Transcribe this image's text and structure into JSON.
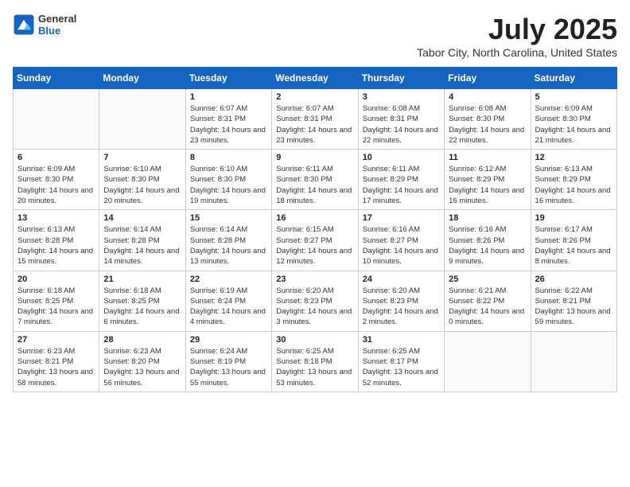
{
  "header": {
    "logo_general": "General",
    "logo_blue": "Blue",
    "main_title": "July 2025",
    "subtitle": "Tabor City, North Carolina, United States"
  },
  "calendar": {
    "days_of_week": [
      "Sunday",
      "Monday",
      "Tuesday",
      "Wednesday",
      "Thursday",
      "Friday",
      "Saturday"
    ],
    "weeks": [
      [
        {
          "day": "",
          "info": ""
        },
        {
          "day": "",
          "info": ""
        },
        {
          "day": "1",
          "info": "Sunrise: 6:07 AM\nSunset: 8:31 PM\nDaylight: 14 hours\nand 23 minutes."
        },
        {
          "day": "2",
          "info": "Sunrise: 6:07 AM\nSunset: 8:31 PM\nDaylight: 14 hours\nand 23 minutes."
        },
        {
          "day": "3",
          "info": "Sunrise: 6:08 AM\nSunset: 8:31 PM\nDaylight: 14 hours\nand 22 minutes."
        },
        {
          "day": "4",
          "info": "Sunrise: 6:08 AM\nSunset: 8:30 PM\nDaylight: 14 hours\nand 22 minutes."
        },
        {
          "day": "5",
          "info": "Sunrise: 6:09 AM\nSunset: 8:30 PM\nDaylight: 14 hours\nand 21 minutes."
        }
      ],
      [
        {
          "day": "6",
          "info": "Sunrise: 6:09 AM\nSunset: 8:30 PM\nDaylight: 14 hours\nand 20 minutes."
        },
        {
          "day": "7",
          "info": "Sunrise: 6:10 AM\nSunset: 8:30 PM\nDaylight: 14 hours\nand 20 minutes."
        },
        {
          "day": "8",
          "info": "Sunrise: 6:10 AM\nSunset: 8:30 PM\nDaylight: 14 hours\nand 19 minutes."
        },
        {
          "day": "9",
          "info": "Sunrise: 6:11 AM\nSunset: 8:30 PM\nDaylight: 14 hours\nand 18 minutes."
        },
        {
          "day": "10",
          "info": "Sunrise: 6:11 AM\nSunset: 8:29 PM\nDaylight: 14 hours\nand 17 minutes."
        },
        {
          "day": "11",
          "info": "Sunrise: 6:12 AM\nSunset: 8:29 PM\nDaylight: 14 hours\nand 16 minutes."
        },
        {
          "day": "12",
          "info": "Sunrise: 6:13 AM\nSunset: 8:29 PM\nDaylight: 14 hours\nand 16 minutes."
        }
      ],
      [
        {
          "day": "13",
          "info": "Sunrise: 6:13 AM\nSunset: 8:28 PM\nDaylight: 14 hours\nand 15 minutes."
        },
        {
          "day": "14",
          "info": "Sunrise: 6:14 AM\nSunset: 8:28 PM\nDaylight: 14 hours\nand 14 minutes."
        },
        {
          "day": "15",
          "info": "Sunrise: 6:14 AM\nSunset: 8:28 PM\nDaylight: 14 hours\nand 13 minutes."
        },
        {
          "day": "16",
          "info": "Sunrise: 6:15 AM\nSunset: 8:27 PM\nDaylight: 14 hours\nand 12 minutes."
        },
        {
          "day": "17",
          "info": "Sunrise: 6:16 AM\nSunset: 8:27 PM\nDaylight: 14 hours\nand 10 minutes."
        },
        {
          "day": "18",
          "info": "Sunrise: 6:16 AM\nSunset: 8:26 PM\nDaylight: 14 hours\nand 9 minutes."
        },
        {
          "day": "19",
          "info": "Sunrise: 6:17 AM\nSunset: 8:26 PM\nDaylight: 14 hours\nand 8 minutes."
        }
      ],
      [
        {
          "day": "20",
          "info": "Sunrise: 6:18 AM\nSunset: 8:25 PM\nDaylight: 14 hours\nand 7 minutes."
        },
        {
          "day": "21",
          "info": "Sunrise: 6:18 AM\nSunset: 8:25 PM\nDaylight: 14 hours\nand 6 minutes."
        },
        {
          "day": "22",
          "info": "Sunrise: 6:19 AM\nSunset: 8:24 PM\nDaylight: 14 hours\nand 4 minutes."
        },
        {
          "day": "23",
          "info": "Sunrise: 6:20 AM\nSunset: 8:23 PM\nDaylight: 14 hours\nand 3 minutes."
        },
        {
          "day": "24",
          "info": "Sunrise: 6:20 AM\nSunset: 8:23 PM\nDaylight: 14 hours\nand 2 minutes."
        },
        {
          "day": "25",
          "info": "Sunrise: 6:21 AM\nSunset: 8:22 PM\nDaylight: 14 hours\nand 0 minutes."
        },
        {
          "day": "26",
          "info": "Sunrise: 6:22 AM\nSunset: 8:21 PM\nDaylight: 13 hours\nand 59 minutes."
        }
      ],
      [
        {
          "day": "27",
          "info": "Sunrise: 6:23 AM\nSunset: 8:21 PM\nDaylight: 13 hours\nand 58 minutes."
        },
        {
          "day": "28",
          "info": "Sunrise: 6:23 AM\nSunset: 8:20 PM\nDaylight: 13 hours\nand 56 minutes."
        },
        {
          "day": "29",
          "info": "Sunrise: 6:24 AM\nSunset: 8:19 PM\nDaylight: 13 hours\nand 55 minutes."
        },
        {
          "day": "30",
          "info": "Sunrise: 6:25 AM\nSunset: 8:18 PM\nDaylight: 13 hours\nand 53 minutes."
        },
        {
          "day": "31",
          "info": "Sunrise: 6:25 AM\nSunset: 8:17 PM\nDaylight: 13 hours\nand 52 minutes."
        },
        {
          "day": "",
          "info": ""
        },
        {
          "day": "",
          "info": ""
        }
      ]
    ]
  }
}
